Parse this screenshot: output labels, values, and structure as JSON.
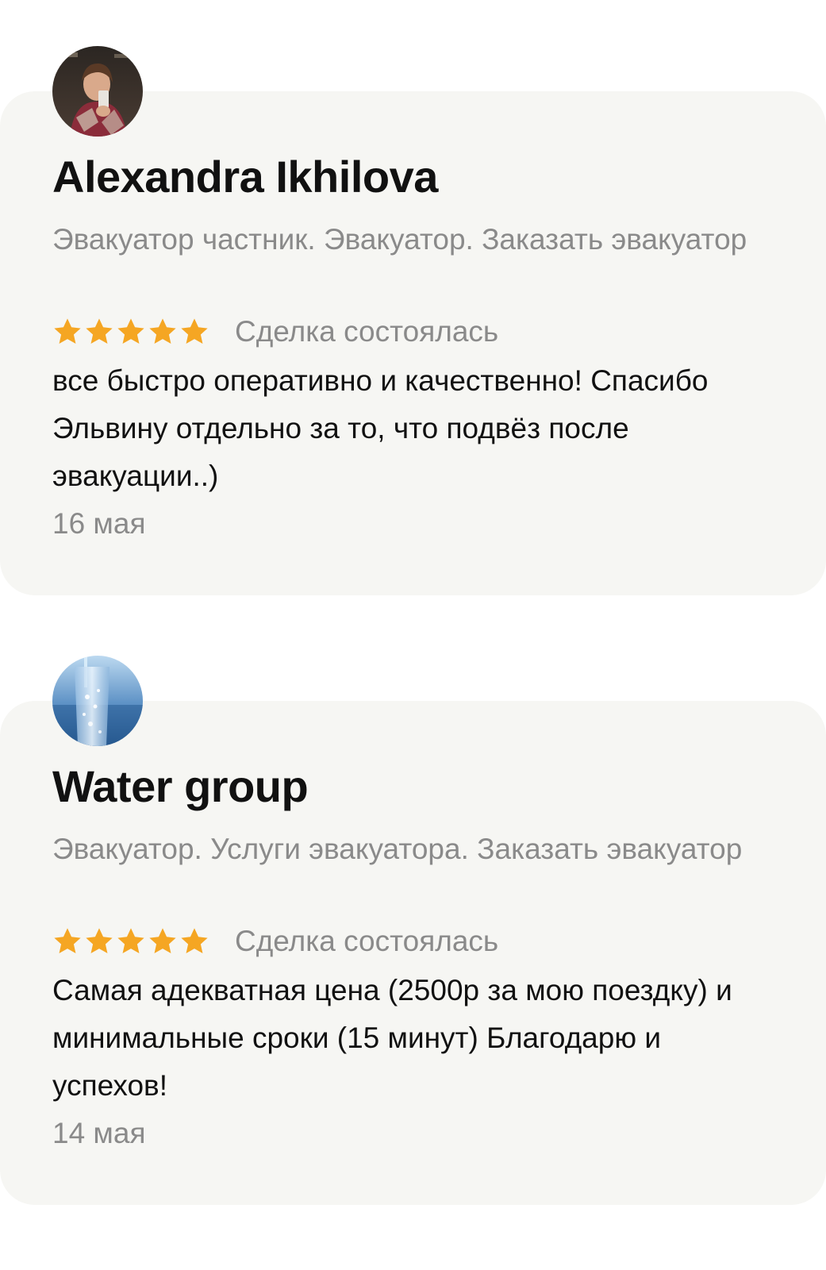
{
  "reviews": [
    {
      "author": "Alexandra Ikhilova",
      "avatar_icon": "user-photo-avatar",
      "service": "Эвакуатор частник. Эвакуатор. Заказать эвакуатор",
      "rating": 5,
      "rating_max": 5,
      "status": "Сделка состоялась",
      "text": "все быстро оперативно и качественно! Спасибо Эльвину отдельно за то, что подвёз после эвакуации..)",
      "date": "16 мая"
    },
    {
      "author": "Water group",
      "avatar_icon": "water-glass-avatar",
      "service": "Эвакуатор. Услуги эвакуатора. Заказать эвакуатор",
      "rating": 5,
      "rating_max": 5,
      "status": "Сделка состоялась",
      "text": "Самая адекватная цена (2500р за мою поездку) и минимальные сроки (15 минут) Благодарю и успехов!",
      "date": "14 мая"
    }
  ],
  "colors": {
    "card_background": "#f6f6f3",
    "star": "#f5a623",
    "secondary_text": "#8a8a8a",
    "primary_text": "#111111"
  }
}
